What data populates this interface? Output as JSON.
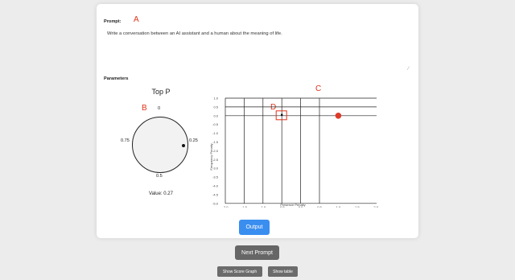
{
  "prompt": {
    "label": "Prompt:",
    "text": "Write a conversation between an AI assistant and a human about the meaning of life."
  },
  "parameters_label": "Parameters",
  "annotations": {
    "a": "A",
    "b": "B",
    "c": "C",
    "d": "D"
  },
  "top_p": {
    "title": "Top P",
    "ticks": {
      "top": "0",
      "right": "0.25",
      "bottom": "0.5",
      "left": "0.75"
    },
    "value_label": "Value: 0.27",
    "value": 0.27
  },
  "penalty_graph": {
    "x_axis_label": "Presence Penalty",
    "y_axis_label": "Frequency Penalty",
    "x_ticks": [
      "-2.0",
      "-1.5",
      "-1.0",
      "-0.5",
      "0.0",
      "0.5",
      "1.0",
      "1.5",
      "2.0"
    ],
    "y_ticks": [
      "1.0",
      "0.5",
      "0.0",
      "-0.5",
      "-1.0",
      "-1.5",
      "-2.0",
      "-2.5",
      "-3.0",
      "-3.5",
      "-4.0",
      "-4.5",
      "-5.0"
    ],
    "highlight_point": {
      "x": -0.5,
      "y": 0.0
    },
    "selected_point": {
      "x": 1.0,
      "y": 0.0
    },
    "colors": {
      "selected": "#dd3b2a",
      "highlight_box": "#e0321a"
    }
  },
  "buttons": {
    "output": "Output",
    "next_prompt": "Next Prompt",
    "show_score_graph": "Show Score Graph",
    "show_table": "Show table"
  }
}
